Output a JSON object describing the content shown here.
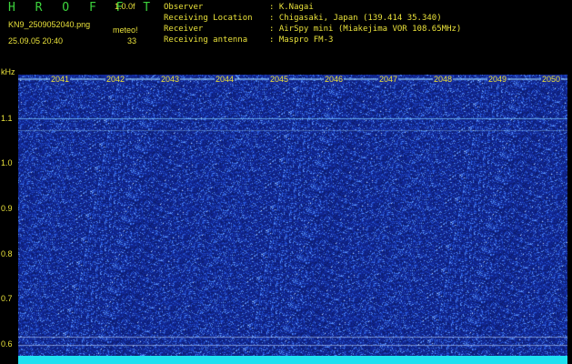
{
  "header": {
    "title": "H R O F F T",
    "version": "1.0.0f",
    "filename": "KN9_2509052040.png",
    "meteo_label": "meteo!",
    "datetime": "25.09.05 20:40",
    "count": "33"
  },
  "info": [
    {
      "key": "Observer",
      "value": ": K.Nagai"
    },
    {
      "key": "Receiving Location",
      "value": ": Chigasaki, Japan (139.414 35.340)"
    },
    {
      "key": "Receiver",
      "value": ": AirSpy mini (Miakejima VOR 108.65MHz)"
    },
    {
      "key": "Receiving antenna",
      "value": ": Maspro FM-3"
    }
  ],
  "axis": {
    "unit": "kHz",
    "y_labels": [
      "1.1",
      "1.0",
      "0.9",
      "0.8",
      "0.7",
      "0.6"
    ],
    "x_labels": [
      "2041",
      "2042",
      "2043",
      "2044",
      "2045",
      "2046",
      "2047",
      "2048",
      "2049",
      "2050"
    ]
  },
  "colors": {
    "background": "#000000",
    "spectrogram": "#1a2f9a",
    "text": "#e8e03a",
    "title": "#3cd23c",
    "bottom_strip": "#1ee0f0"
  }
}
